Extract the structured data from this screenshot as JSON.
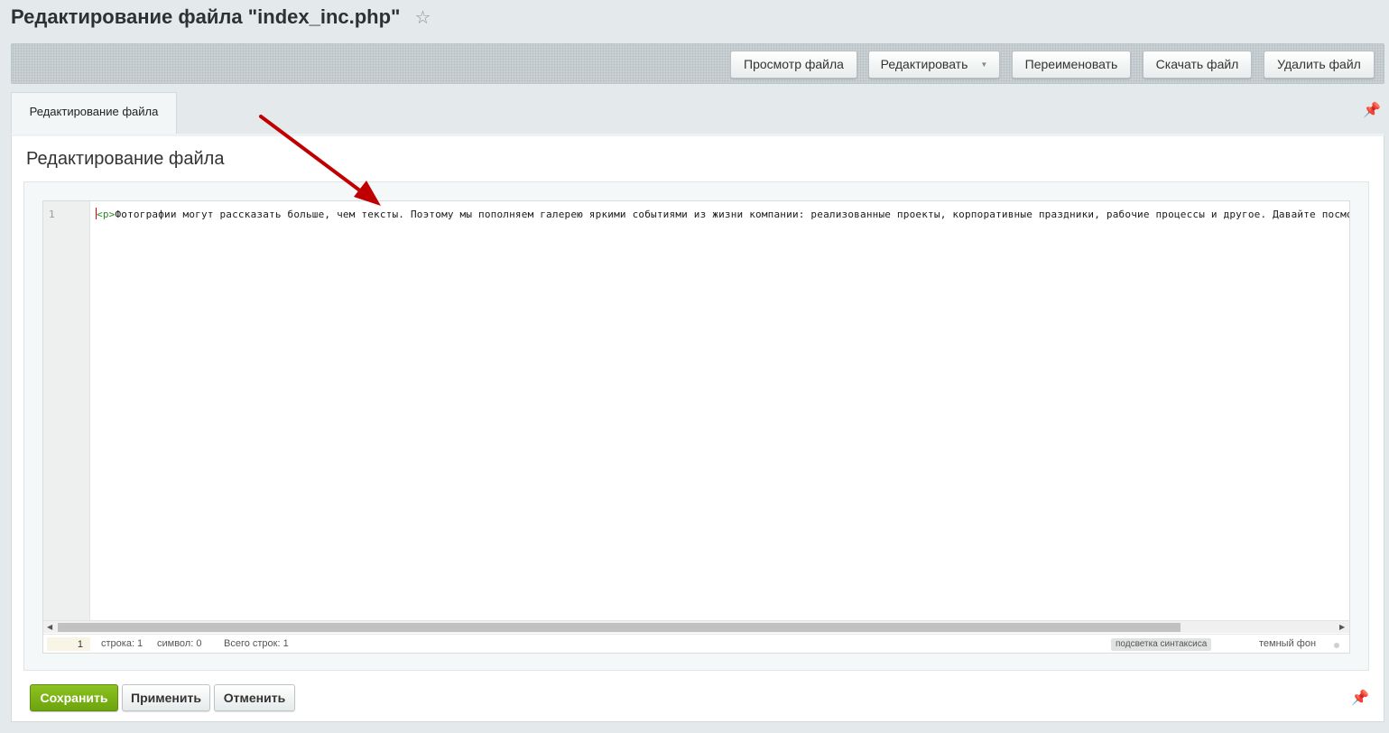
{
  "page": {
    "title": "Редактирование файла \"index_inc.php\"",
    "star_icon": "☆"
  },
  "toolbar": {
    "view_label": "Просмотр файла",
    "edit_label": "Редактировать",
    "edit_caret": "▼",
    "rename_label": "Переименовать",
    "download_label": "Скачать файл",
    "delete_label": "Удалить файл"
  },
  "tabs": {
    "active_label": "Редактирование файла",
    "pin_icon": "📌"
  },
  "section": {
    "title": "Редактирование файла"
  },
  "editor": {
    "line_number": "1",
    "tag_text": "<p>",
    "code_text": "Фотографии могут рассказать больше, чем тексты. Поэтому мы пополняем галерею яркими событиями из жизни компании: реализованные проекты, корпоративные праздники, рабочие процессы и другое. Давайте посмотрим",
    "scroll_left": "◀",
    "scroll_right": "▶",
    "scroll_position": 0
  },
  "status": {
    "goto_value": "1",
    "line_text": "строка: 1",
    "symbol_text": "символ: 0",
    "total_text": "Всего строк: 1",
    "syntax_label": "подсветка синтаксиса",
    "dark_label": "темный фон"
  },
  "actions": {
    "save_label": "Сохранить",
    "apply_label": "Применить",
    "cancel_label": "Отменить",
    "pin_icon": "📌"
  },
  "colors": {
    "save_button": "#7ab317",
    "annotation_arrow": "#c00000",
    "html_tag": "#2a8a2a"
  }
}
